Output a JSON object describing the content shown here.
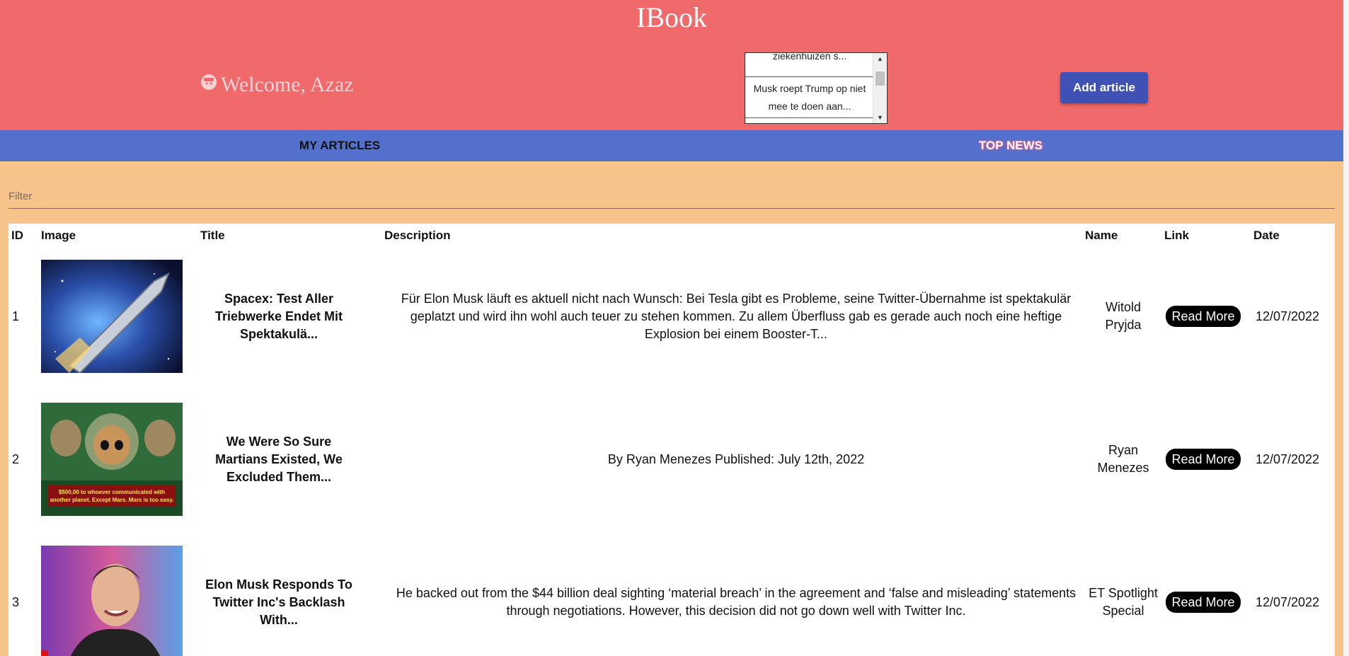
{
  "app": {
    "title": "IBook"
  },
  "header": {
    "welcome": "Welcome, Azaz",
    "add_button": "Add article",
    "ticker": [
      "ziekenhuizen s...",
      "Musk roept Trump op niet mee te doen aan..."
    ]
  },
  "tabs": [
    {
      "label": "MY ARTICLES",
      "active": false
    },
    {
      "label": "TOP NEWS",
      "active": true
    }
  ],
  "filter": {
    "placeholder": "Filter",
    "value": ""
  },
  "table": {
    "columns": [
      "ID",
      "Image",
      "Title",
      "Description",
      "Name",
      "Link",
      "Date"
    ],
    "rows": [
      {
        "id": "1",
        "image": "spacex-rocket-image",
        "title": "Spacex: Test Aller Triebwerke Endet Mit Spektakulä...",
        "description": "Für Elon Musk läuft es aktuell nicht nach Wunsch: Bei Tesla gibt es Probleme, seine Twitter-Übernahme ist spektakulär geplatzt und wird ihn wohl auch teuer zu stehen kommen. Zu allem Überfluss gab es gerade auch noch eine heftige Explosion bei einem Booster-T...",
        "name": "Witold Pryjda",
        "link": "Read More",
        "date": "12/07/2022"
      },
      {
        "id": "2",
        "image": "martians-image",
        "image_caption": "$500,00 to whoever communicated with another planet. Except Mars. Mars is too easy.",
        "title": "We Were So Sure Martians Existed, We Excluded Them...",
        "description": "By Ryan Menezes Published: July 12th, 2022",
        "name": "Ryan Menezes",
        "link": "Read More",
        "date": "12/07/2022"
      },
      {
        "id": "3",
        "image": "elon-musk-photo",
        "title": "Elon Musk Responds To Twitter Inc's Backlash With...",
        "description": "He backed out from the $44 billion deal sighting ‘material breach’ in the agreement and ‘false and misleading’ statements through negotiations. However, this decision did not go down well with Twitter Inc.",
        "name": "ET Spotlight Special",
        "link": "Read More",
        "date": "12/07/2022"
      }
    ]
  },
  "colors": {
    "header": "#f06a6c",
    "tabs": "#5470cd",
    "page": "#f6c48b",
    "primary_button": "#3f51b5"
  }
}
